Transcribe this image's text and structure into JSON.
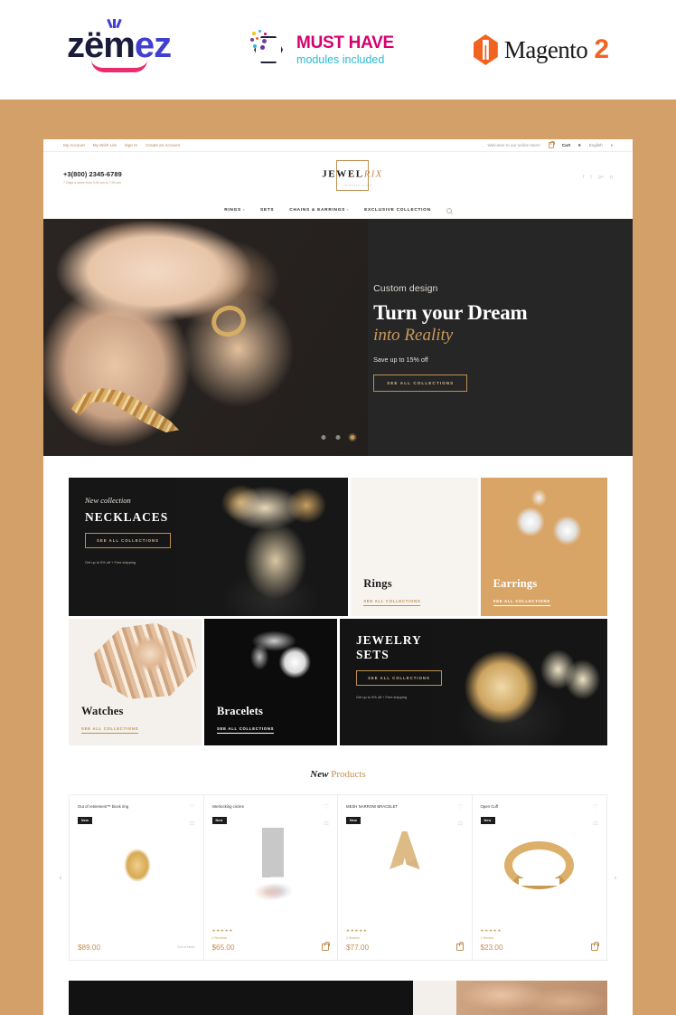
{
  "promo": {
    "zemez": {
      "text": "zemez",
      "letters": [
        "z",
        "ë",
        "m",
        "e",
        "z"
      ]
    },
    "musthave": {
      "title": "MUST HAVE",
      "subtitle": "modules included"
    },
    "magento": {
      "name": "Magento",
      "version": "2"
    }
  },
  "site": {
    "topbar": {
      "links": [
        "My Account",
        "My Wish List",
        "Sign In",
        "Create an Account"
      ],
      "welcome": "Welcome to our online store!",
      "cart_label": "Cart",
      "cart_count": "0",
      "language": "English"
    },
    "header": {
      "phone": "+3(800) 2345-6789",
      "hours": "7 Days a week from 9:00 am to 7:00 pm",
      "logo_main": "JEWEL",
      "logo_accent": "RIX",
      "logo_sub": "Jewelry store",
      "social": [
        "f",
        "t",
        "g+",
        "p"
      ]
    },
    "nav": {
      "items": [
        {
          "label": "RINGS",
          "has_dropdown": true
        },
        {
          "label": "SETS",
          "has_dropdown": false
        },
        {
          "label": "CHAINS & EARRINGS",
          "has_dropdown": true
        },
        {
          "label": "EXCLUSIVE COLLECTION",
          "has_dropdown": false
        }
      ],
      "search_icon": "search-icon"
    },
    "hero": {
      "kicker": "Custom design",
      "title": "Turn your Dream",
      "title2": "into Reality",
      "note": "Save up to 15% off",
      "button": "SEE ALL COLLECTIONS",
      "dots": 3,
      "active_dot": 3
    },
    "categories": {
      "necklaces": {
        "kicker": "New collection",
        "title": "NECKLACES",
        "button": "SEE ALL COLLECTIONS",
        "note": "Get up to 5% off + Free shipping"
      },
      "rings": {
        "title": "Rings",
        "link": "SEE ALL COLLECTIONS"
      },
      "earrings": {
        "title": "Earrings",
        "link": "SEE ALL COLLECTIONS"
      },
      "watches": {
        "title": "Watches",
        "link": "SEE ALL COLLECTIONS"
      },
      "bracelets": {
        "title": "Bracelets",
        "link": "SEE ALL COLLECTIONS"
      },
      "sets": {
        "title_line1": "JEWELRY",
        "title_line2": "SETS",
        "button": "SEE ALL COLLECTIONS",
        "note": "Get up to 5% off + Free shipping"
      }
    },
    "new_products": {
      "heading_a": "New",
      "heading_b": "Products",
      "prev_arrow": "‹",
      "next_arrow": "›",
      "items": [
        {
          "name": "Out of retirement™ block ring",
          "badge": "New",
          "stars": "",
          "reviews": "",
          "price": "$89.00",
          "stock": "Out of stock",
          "has_cart": false
        },
        {
          "name": "Interlocking circles",
          "badge": "New",
          "stars": "★★★★★",
          "reviews": "2 Reviews",
          "price": "$65.00",
          "stock": "",
          "has_cart": true
        },
        {
          "name": "MESH NARROW BRACELET",
          "badge": "New",
          "stars": "★★★★★",
          "reviews": "1 Review",
          "price": "$77.00",
          "stock": "",
          "has_cart": true
        },
        {
          "name": "Open Cuff",
          "badge": "New",
          "stars": "★★★★★",
          "reviews": "1 Review",
          "price": "$23.00",
          "stock": "",
          "has_cart": true
        }
      ]
    }
  },
  "colors": {
    "frame_tan": "#d4a06a",
    "gold": "#c08f51",
    "dark": "#1c1c1c",
    "magento_orange": "#f26322",
    "zemez_pink": "#ec2a6e",
    "zemez_blue": "#4040d0",
    "musthave_pink": "#d6006e",
    "musthave_cyan": "#29b9d4"
  }
}
